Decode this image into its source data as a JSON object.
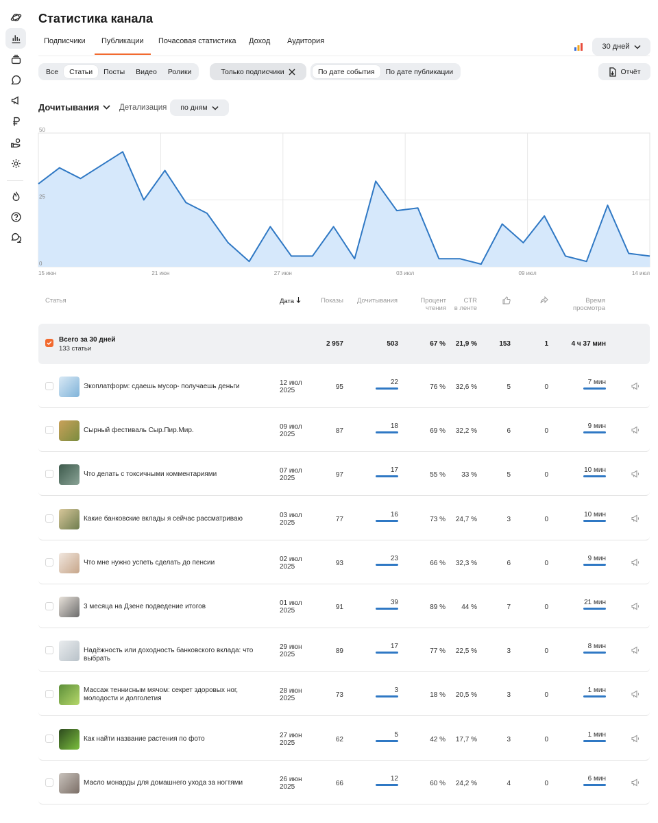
{
  "header": {
    "title": "Статистика канала"
  },
  "tabs": [
    {
      "label": "Подписчики"
    },
    {
      "label": "Публикации"
    },
    {
      "label": "Почасовая статистика"
    },
    {
      "label": "Доход"
    },
    {
      "label": "Аудитория"
    }
  ],
  "period": {
    "label": "30 дней"
  },
  "type_filter": [
    "Все",
    "Статьи",
    "Посты",
    "Видео",
    "Ролики"
  ],
  "subscribers_filter": {
    "label": "Только подписчики"
  },
  "date_mode": [
    "По дате события",
    "По дате публикации"
  ],
  "report": {
    "label": "Отчёт"
  },
  "metric": {
    "label": "Дочитывания"
  },
  "detail": {
    "label": "Детализация",
    "value": "по дням"
  },
  "chart_data": {
    "type": "area",
    "x_tick_labels": [
      "15 июн",
      "21 июн",
      "27 июн",
      "03 июл",
      "09 июл",
      "14 июл"
    ],
    "y_tick_labels": [
      "50",
      "25",
      "0"
    ],
    "ylim": [
      0,
      50
    ],
    "grid": true,
    "color": "#2f78c4",
    "fill": "#d6e8fb",
    "series": [
      {
        "values": [
          31,
          37,
          33,
          38,
          43,
          25,
          36,
          24,
          20,
          9,
          2,
          15,
          4,
          4,
          15,
          3,
          32,
          21,
          22,
          3,
          3,
          1,
          16,
          9,
          19,
          4,
          2,
          23,
          5,
          4
        ]
      }
    ]
  },
  "table": {
    "headers": {
      "article": "Статья",
      "date": "Дата",
      "views": "Показы",
      "reads": "Дочитывания",
      "read_pct_1": "Процент",
      "read_pct_2": "чтения",
      "ctr_1": "CTR",
      "ctr_2": "в ленте",
      "time_1": "Время",
      "time_2": "просмотра"
    },
    "icons": {
      "likes": "thumbs-up-icon",
      "shares": "share-icon",
      "promote": "megaphone-icon"
    },
    "total": {
      "title": "Всего за 30 дней",
      "subtitle": "133 статьи",
      "views": "2 957",
      "reads": "503",
      "read_pct": "67 %",
      "ctr": "21,9 %",
      "likes": "153",
      "shares": "1",
      "time": "4 ч 37 мин"
    },
    "rows": [
      {
        "title": "Экоплатформ: сдаешь мусор- получаешь деньги",
        "date1": "12 июл",
        "date2": "2025",
        "views": "95",
        "reads": "22",
        "read_pct": "76 %",
        "ctr": "32,6 %",
        "likes": "5",
        "shares": "0",
        "time": "7 мин"
      },
      {
        "title": "Сырный фестиваль Сыр.Пир.Мир.",
        "date1": "09 июл",
        "date2": "2025",
        "views": "87",
        "reads": "18",
        "read_pct": "69 %",
        "ctr": "32,2 %",
        "likes": "6",
        "shares": "0",
        "time": "9 мин"
      },
      {
        "title": "Что делать с токсичными комментариями",
        "date1": "07 июл",
        "date2": "2025",
        "views": "97",
        "reads": "17",
        "read_pct": "55 %",
        "ctr": "33 %",
        "likes": "5",
        "shares": "0",
        "time": "10 мин"
      },
      {
        "title": "Какие банковские вклады я сейчас рассматриваю",
        "date1": "03 июл",
        "date2": "2025",
        "views": "77",
        "reads": "16",
        "read_pct": "73 %",
        "ctr": "24,7 %",
        "likes": "3",
        "shares": "0",
        "time": "10 мин"
      },
      {
        "title": "Что мне нужно успеть сделать до пенсии",
        "date1": "02 июл",
        "date2": "2025",
        "views": "93",
        "reads": "23",
        "read_pct": "66 %",
        "ctr": "32,3 %",
        "likes": "6",
        "shares": "0",
        "time": "9 мин"
      },
      {
        "title": "3 месяца на Дзене подведение итогов",
        "date1": "01 июл",
        "date2": "2025",
        "views": "91",
        "reads": "39",
        "read_pct": "89 %",
        "ctr": "44 %",
        "likes": "7",
        "shares": "0",
        "time": "21 мин"
      },
      {
        "title": "Надёжность или доходность банковского вклада: что выбрать",
        "date1": "29 июн",
        "date2": "2025",
        "views": "89",
        "reads": "17",
        "read_pct": "77 %",
        "ctr": "22,5 %",
        "likes": "3",
        "shares": "0",
        "time": "8 мин"
      },
      {
        "title": "Массаж теннисным мячом: секрет здоровых ног, молодости и долголетия",
        "date1": "28 июн",
        "date2": "2025",
        "views": "73",
        "reads": "3",
        "read_pct": "18 %",
        "ctr": "20,5 %",
        "likes": "3",
        "shares": "0",
        "time": "1 мин"
      },
      {
        "title": "Как найти название растения по фото",
        "date1": "27 июн",
        "date2": "2025",
        "views": "62",
        "reads": "5",
        "read_pct": "42 %",
        "ctr": "17,7 %",
        "likes": "3",
        "shares": "0",
        "time": "1 мин"
      },
      {
        "title": "Масло монарды для домашнего ухода за ногтями",
        "date1": "26 июн",
        "date2": "2025",
        "views": "66",
        "reads": "12",
        "read_pct": "60 %",
        "ctr": "24,2 %",
        "likes": "4",
        "shares": "0",
        "time": "6 мин"
      }
    ]
  },
  "colors": {
    "accent": "#f26a2f",
    "line": "#2f78c4",
    "area": "#d6e8fb",
    "chip_bg": "#eceef1"
  }
}
